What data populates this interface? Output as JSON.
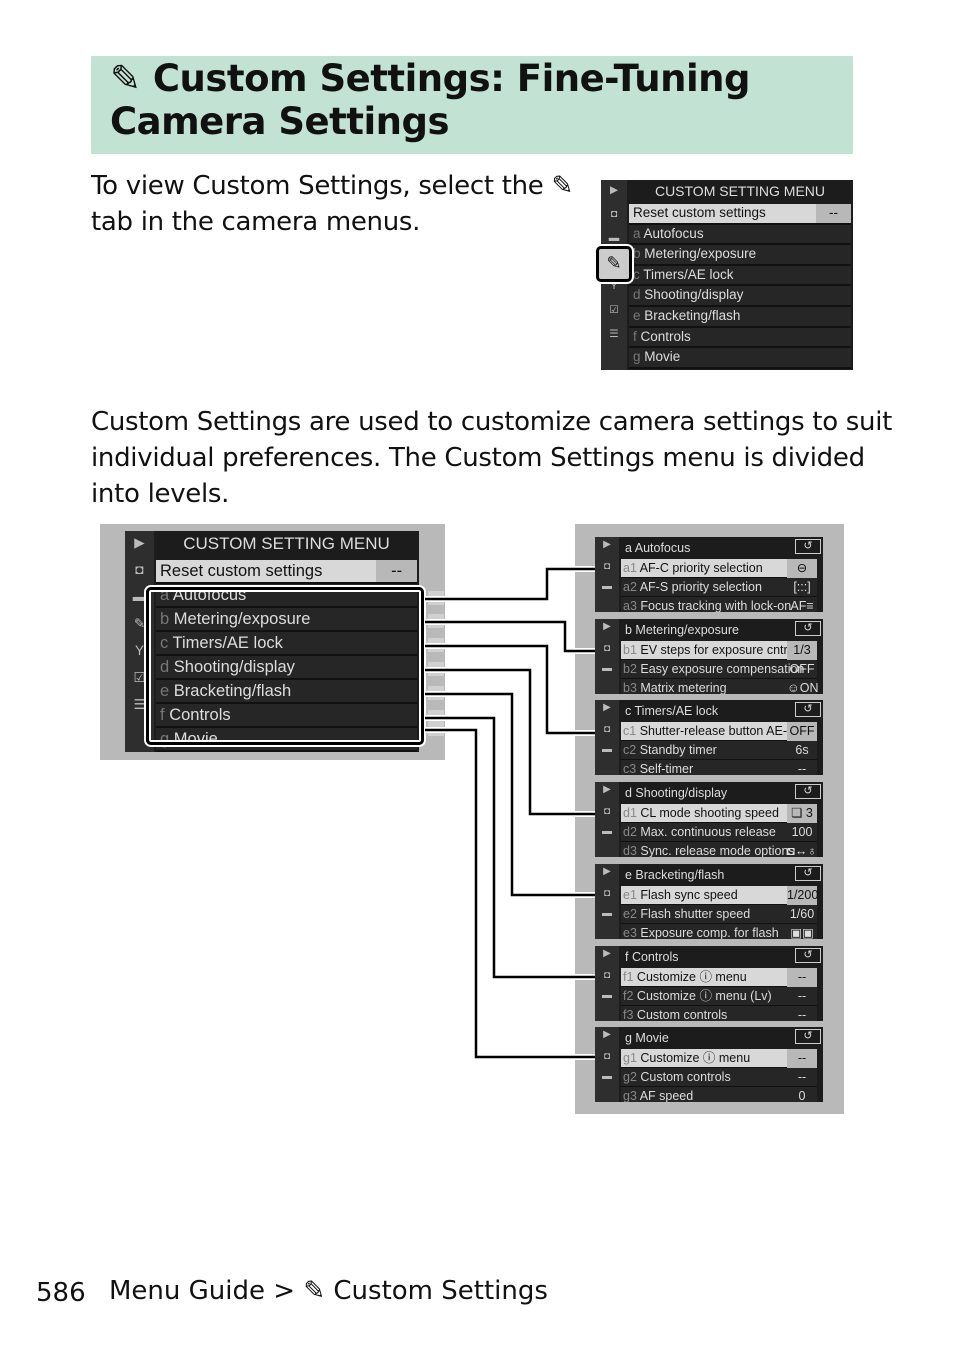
{
  "heading": {
    "icon": "pencil-icon",
    "title_line1": "Custom Settings: Fine-Tuning",
    "title_line2": "Camera Settings"
  },
  "intro": {
    "line1": "To view Custom Settings, select the",
    "line2": "tab in the camera menus."
  },
  "body": {
    "line1": "Custom Settings are used to customize camera settings to suit",
    "line2": "individual preferences. The Custom Settings menu is divided",
    "line3": "into levels."
  },
  "menu": {
    "title": "CUSTOM SETTING MENU",
    "reset": "Reset custom settings",
    "reset_value": "--",
    "items": [
      {
        "letter": "a",
        "label": "Autofocus"
      },
      {
        "letter": "b",
        "label": "Metering/exposure"
      },
      {
        "letter": "c",
        "label": "Timers/AE lock"
      },
      {
        "letter": "d",
        "label": "Shooting/display"
      },
      {
        "letter": "e",
        "label": "Bracketing/flash"
      },
      {
        "letter": "f",
        "label": "Controls"
      },
      {
        "letter": "g",
        "label": "Movie"
      }
    ],
    "side_icons": [
      "playback-icon",
      "camera-icon",
      "movie-icon",
      "pencil-icon",
      "wrench-icon",
      "retouch-icon",
      "my-menu-icon"
    ]
  },
  "panels": [
    {
      "title": "a Autofocus",
      "rows": [
        {
          "n": "a1",
          "label": "AF-C priority selection",
          "value": "⊖"
        },
        {
          "n": "a2",
          "label": "AF-S priority selection",
          "value": "[:::]"
        },
        {
          "n": "a3",
          "label": "Focus tracking with lock-on",
          "value": "AF≡"
        }
      ]
    },
    {
      "title": "b Metering/exposure",
      "rows": [
        {
          "n": "b1",
          "label": "EV steps for exposure cntrl",
          "value": "1/3"
        },
        {
          "n": "b2",
          "label": "Easy exposure compensation",
          "value": "OFF"
        },
        {
          "n": "b3",
          "label": "Matrix metering",
          "value": "☺ON"
        }
      ]
    },
    {
      "title": "c Timers/AE lock",
      "rows": [
        {
          "n": "c1",
          "label": "Shutter-release button AE-L",
          "value": "OFF"
        },
        {
          "n": "c2",
          "label": "Standby timer",
          "value": "6s"
        },
        {
          "n": "c3",
          "label": "Self-timer",
          "value": "--"
        }
      ]
    },
    {
      "title": "d Shooting/display",
      "rows": [
        {
          "n": "d1",
          "label": "CL mode shooting speed",
          "value": "❏ 3"
        },
        {
          "n": "d2",
          "label": "Max. continuous release",
          "value": "100"
        },
        {
          "n": "d3",
          "label": "Sync. release mode options",
          "value": "◘↔♁"
        }
      ]
    },
    {
      "title": "e Bracketing/flash",
      "rows": [
        {
          "n": "e1",
          "label": "Flash sync speed",
          "value": "1/200"
        },
        {
          "n": "e2",
          "label": "Flash shutter speed",
          "value": "1/60"
        },
        {
          "n": "e3",
          "label": "Exposure comp. for flash",
          "value": "▣▣"
        }
      ]
    },
    {
      "title": "f Controls",
      "rows": [
        {
          "n": "f1",
          "label": "Customize ⓘ menu",
          "value": "--"
        },
        {
          "n": "f2",
          "label": "Customize ⓘ menu (Lv)",
          "value": "--"
        },
        {
          "n": "f3",
          "label": "Custom controls",
          "value": "--"
        }
      ]
    },
    {
      "title": "g Movie",
      "rows": [
        {
          "n": "g1",
          "label": "Customize ⓘ menu",
          "value": "--"
        },
        {
          "n": "g2",
          "label": "Custom controls",
          "value": "--"
        },
        {
          "n": "g3",
          "label": "AF speed",
          "value": "0"
        }
      ]
    }
  ],
  "footer": {
    "page": "586",
    "crumb1": "Menu Guide",
    "sep": ">",
    "crumb2": "Custom Settings"
  }
}
